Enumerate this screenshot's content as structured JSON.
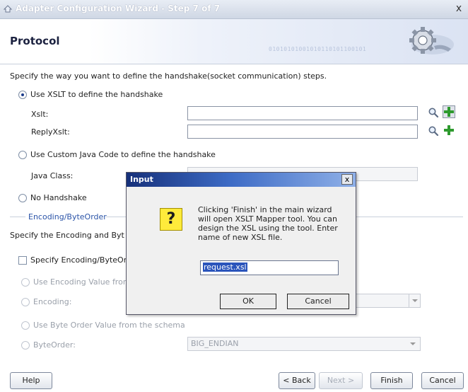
{
  "window": {
    "title": "Adapter Configuration Wizard - Step 7 of 7",
    "close_label": "x"
  },
  "header": {
    "title": "Protocol",
    "binary_pattern": "01010101001010110101100101"
  },
  "main": {
    "instruction": "Specify the way you want to define the handshake(socket communication) steps.",
    "xslt_radio_label": "Use XSLT to define the handshake",
    "xslt_selected": true,
    "xslt_label": "Xslt:",
    "xslt_value": "",
    "reply_xslt_label": "ReplyXslt:",
    "reply_xslt_value": "",
    "custom_java_radio_label": "Use Custom Java Code to define the handshake",
    "java_class_label": "Java Class:",
    "java_class_value": "",
    "no_handshake_radio_label": "No Handshake",
    "encoding_section_label": "Encoding/ByteOrder",
    "encoding_instruction": "Specify the Encoding and Byt",
    "specify_encoding_label": "Specify Encoding/ByteOrc",
    "use_encoding_schema_label": "Use Encoding Value from",
    "encoding_label": "Encoding:",
    "encoding_value": "",
    "use_byteorder_schema_label": "Use Byte Order Value from the schema",
    "byteorder_label": "ByteOrder:",
    "byteorder_value": "BIG_ENDIAN"
  },
  "footer": {
    "help": "Help",
    "back": "< Back",
    "next": "Next >",
    "finish": "Finish",
    "cancel": "Cancel"
  },
  "dialog": {
    "title": "Input",
    "close_label": "x",
    "icon_glyph": "?",
    "message": "Clicking 'Finish' in the main wizard will open XSLT Mapper tool. You can design the XSL using the tool. Enter name of new XSL file.",
    "input_value": "request.xsl",
    "ok": "OK",
    "cancel": "Cancel"
  },
  "colors": {
    "title_gradient_start": "#16307a",
    "title_gradient_end": "#8fb0e8",
    "add_icon_green": "#2e9a2e",
    "question_icon_yellow": "#ffeb3b"
  },
  "icons": {
    "search": "search-icon",
    "add": "add-icon",
    "gear": "gear-icon",
    "question": "question-icon"
  }
}
